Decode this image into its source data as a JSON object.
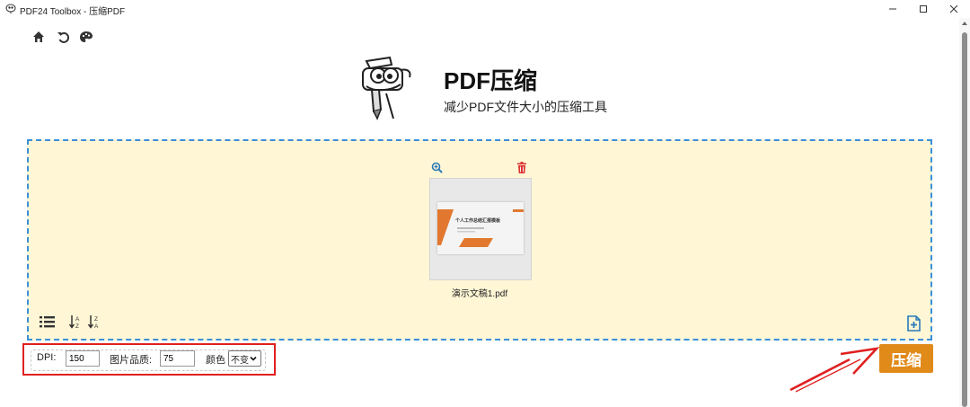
{
  "window": {
    "title": "PDF24 Toolbox - 压缩PDF",
    "controls": [
      "minimize",
      "maximize",
      "close"
    ]
  },
  "toolbar": {
    "icons": [
      "home-icon",
      "undo-icon",
      "palette-icon"
    ]
  },
  "header": {
    "title": "PDF压缩",
    "subtitle": "减少PDF文件大小的压缩工具"
  },
  "files": [
    {
      "name": "演示文稿1.pdf",
      "thumbnail_title": "个人工作总结汇报模板"
    }
  ],
  "dropzone_tools": {
    "icons": [
      "list-view-icon",
      "sort-a-z-icon",
      "sort-z-a-icon",
      "add-file-icon"
    ]
  },
  "options": {
    "dpi_label": "DPI:",
    "dpi_value": "150",
    "quality_label": "图片品质:",
    "quality_value": "75",
    "color_label": "颜色",
    "color_value": "不变"
  },
  "actions": {
    "compress_label": "压缩"
  },
  "colors": {
    "dropzone_bg": "#fff6d5",
    "dropzone_border": "#3a8fd8",
    "primary_button": "#e08a1a",
    "highlight_red": "#e02020",
    "toolbar_icon": "#333333"
  }
}
